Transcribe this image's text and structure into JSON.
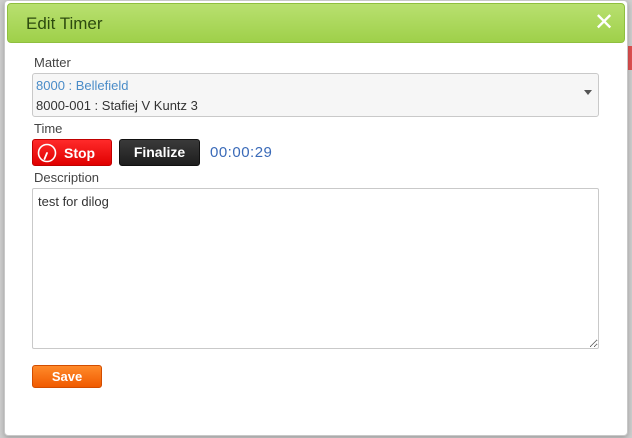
{
  "dialog": {
    "title": "Edit Timer",
    "close_glyph": "✕"
  },
  "matter": {
    "label": "Matter",
    "client": "8000 : Bellefield",
    "matter": "8000-001 : Stafiej V Kuntz 3"
  },
  "time": {
    "label": "Time",
    "stop_label": "Stop",
    "finalize_label": "Finalize",
    "elapsed": "00:00:29"
  },
  "description": {
    "label": "Description",
    "value": "test for dilog"
  },
  "actions": {
    "save_label": "Save"
  },
  "colors": {
    "titlebar": "#a8d85a",
    "stop": "#ff1a1a",
    "finalize": "#2a2a2a",
    "save": "#f26b0f",
    "timer_text": "#3a6ab8",
    "client_text": "#4a8cc8"
  },
  "icons": {
    "stop": "stopwatch-icon",
    "close": "close-icon",
    "select": "chevron-down-icon"
  }
}
